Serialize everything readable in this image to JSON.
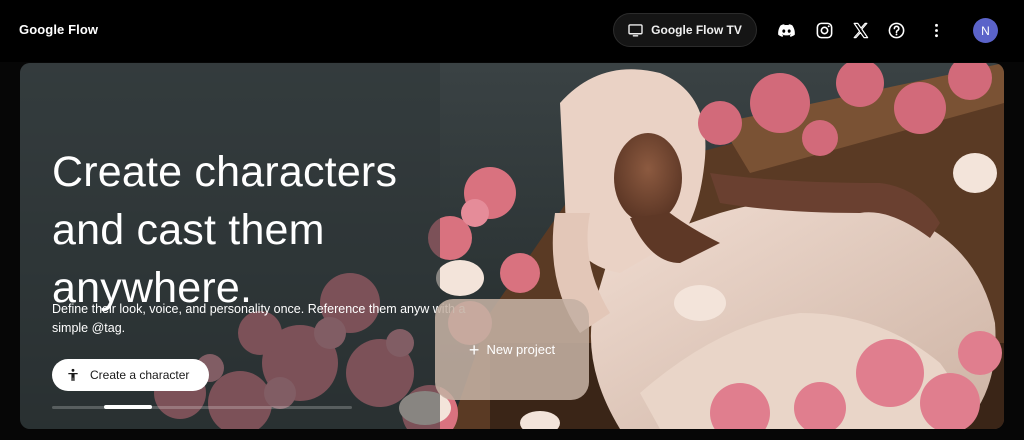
{
  "header": {
    "brand": "Google Flow",
    "tv_button_label": "Google Flow TV",
    "avatar_initial": "N",
    "icons": [
      "tv-icon",
      "discord-icon",
      "instagram-icon",
      "x-icon",
      "help-icon",
      "more-vert-icon"
    ]
  },
  "hero": {
    "title": "Create characters and cast them anywhere.",
    "description": "Define their look, voice, and personality once. Reference them anyw with a simple @tag.",
    "cta_label": "Create a character",
    "carousel_active_index": 1
  },
  "new_project": {
    "label": "New project"
  },
  "colors": {
    "background": "#000000",
    "avatar": "#5b63c9",
    "hero_bg": "#2f3738",
    "new_project_card": "#c4b0a3"
  }
}
